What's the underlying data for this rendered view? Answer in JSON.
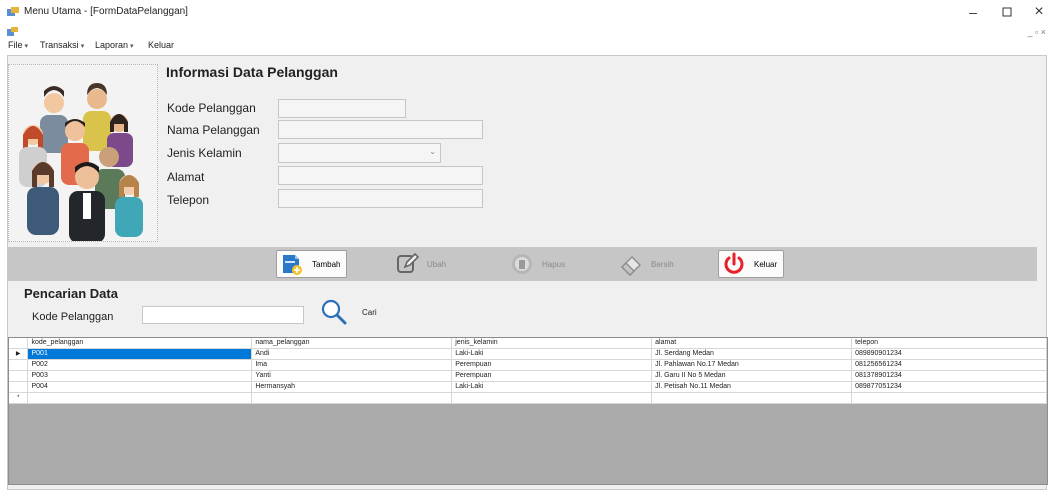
{
  "window": {
    "title": "Menu Utama - [FormDataPelanggan]",
    "minimize_glyph": "–",
    "maximize_glyph": "▫",
    "close_glyph": "×",
    "mdi_controls": "_ ▫ ×"
  },
  "menu": {
    "items": [
      "File",
      "Transaksi",
      "Laporan",
      "Keluar"
    ],
    "caret": "▾"
  },
  "form": {
    "title": "Informasi Data Pelanggan",
    "fields": {
      "kode": {
        "label": "Kode Pelanggan",
        "value": ""
      },
      "nama": {
        "label": "Nama Pelanggan",
        "value": ""
      },
      "jenis": {
        "label": "Jenis Kelamin",
        "value": ""
      },
      "alamat": {
        "label": "Alamat",
        "value": ""
      },
      "telepon": {
        "label": "Telepon",
        "value": ""
      }
    },
    "combo_arrow": "⌄"
  },
  "toolbar": {
    "tambah": "Tambah",
    "ubah": "Ubah",
    "hapus": "Hapus",
    "bersih": "Bersih",
    "keluar": "Keluar"
  },
  "search": {
    "title": "Pencarian Data",
    "label": "Kode Pelanggan",
    "value": "",
    "button": "Cari"
  },
  "grid": {
    "columns": [
      "kode_pelanggan",
      "nama_pelanggan",
      "jenis_kelamin",
      "alamat",
      "telepon"
    ],
    "current_row_marker": "▶",
    "new_row_marker": "*",
    "rows": [
      [
        "P001",
        "Andi",
        "Laki-Laki",
        "Jl. Serdang Medan",
        "089890901234"
      ],
      [
        "P002",
        "Ima",
        "Perempuan",
        "Jl. Pahlawan No.17 Medan",
        "081256561234"
      ],
      [
        "P003",
        "Yanti",
        "Perempuan",
        "Jl. Garu II No 5 Medan",
        "081378901234"
      ],
      [
        "P004",
        "Hermansyah",
        "Laki-Laki",
        "Jl. Petisah No.11 Medan",
        "089877051234"
      ]
    ]
  },
  "colors": {
    "selection": "#0078d7",
    "toolbar_bg": "#c6c6c6",
    "form_bg": "#f0f0f0",
    "power_icon": "#e8202a"
  }
}
